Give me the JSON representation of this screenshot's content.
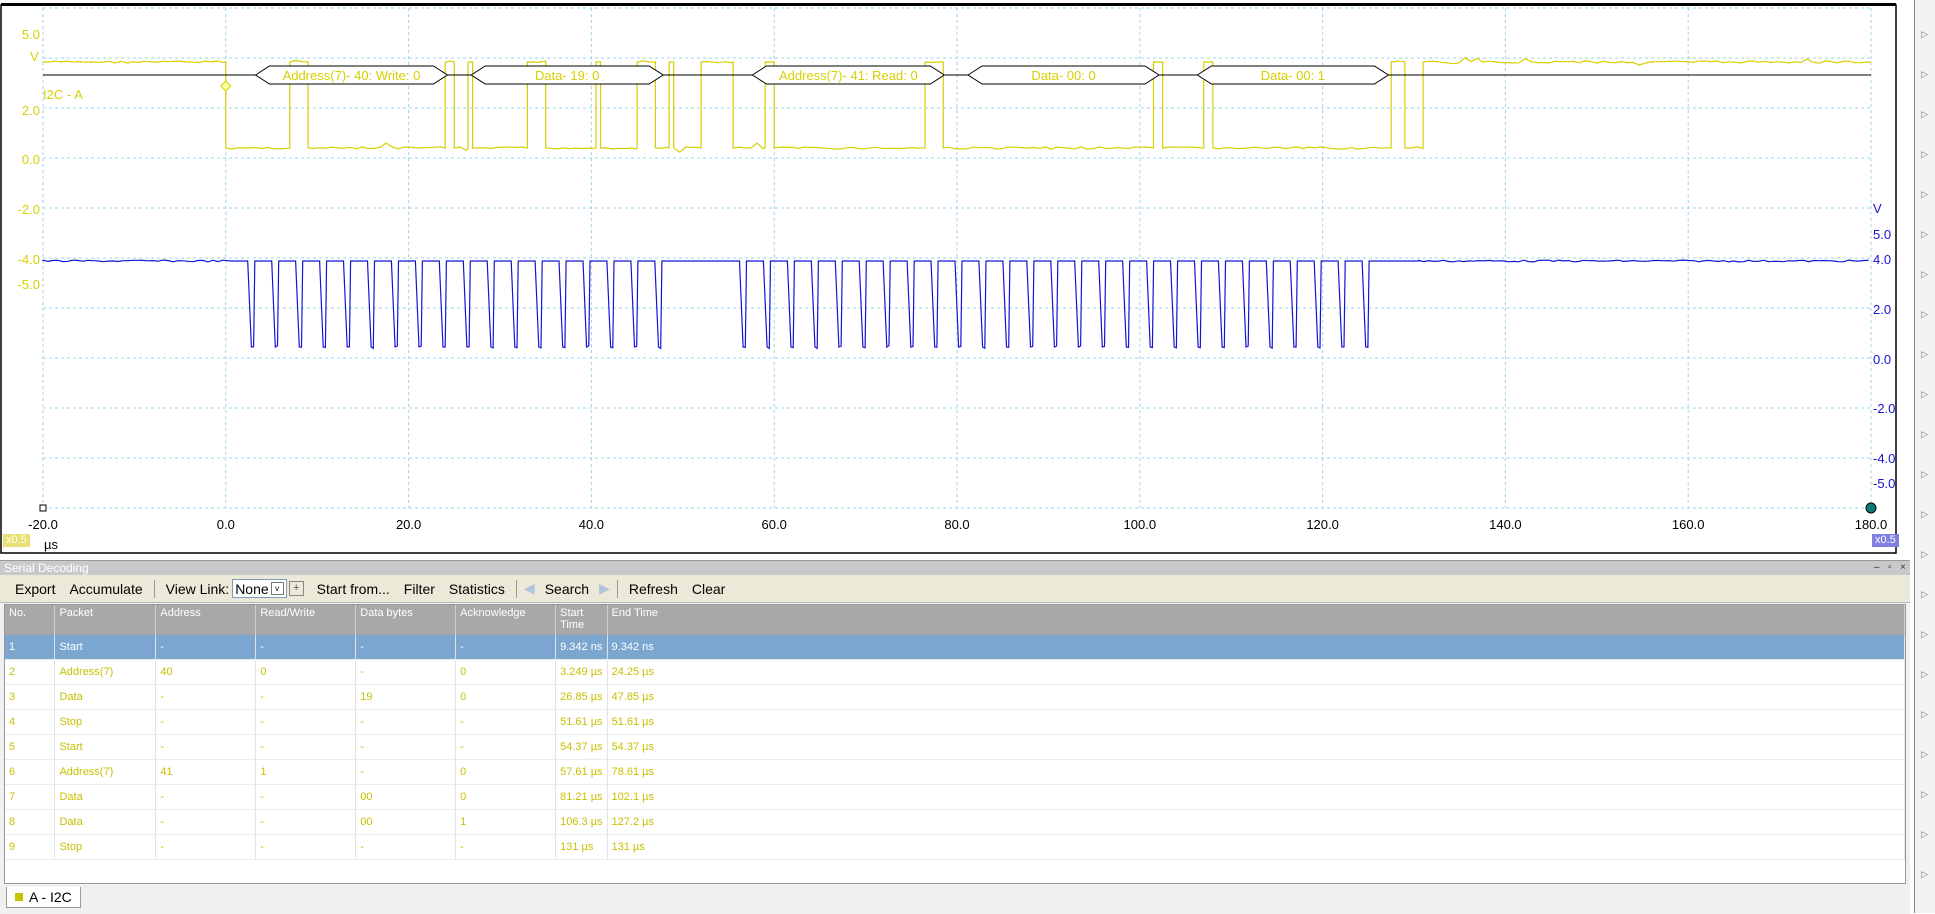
{
  "scope": {
    "channel_a": {
      "color": "#d6d000",
      "unit": "V",
      "axis_ticks": [
        "5.0",
        "2.0",
        "0.0",
        "-2.0",
        "-4.0",
        "-5.0"
      ],
      "scale_badge": "x0.5",
      "decoder_label": "I2C - A"
    },
    "channel_b": {
      "color": "#1414d4",
      "unit": "V",
      "axis_ticks": [
        "5.0",
        "4.0",
        "2.0",
        "0.0",
        "-2.0",
        "-4.0",
        "-5.0"
      ],
      "scale_badge": "x0.5"
    },
    "time_axis": {
      "ticks": [
        "-20.0",
        "0.0",
        "20.0",
        "40.0",
        "60.0",
        "80.0",
        "100.0",
        "120.0",
        "140.0",
        "160.0",
        "180.0"
      ],
      "unit": "µs"
    },
    "decode_packets": [
      {
        "label": "Address(7)- 40: Write: 0",
        "start_us": 3.249,
        "end_us": 24.25
      },
      {
        "label": "Data- 19: 0",
        "start_us": 26.85,
        "end_us": 47.85
      },
      {
        "label": "Address(7)- 41: Read: 0",
        "start_us": 57.61,
        "end_us": 78.61
      },
      {
        "label": "Data- 00: 0",
        "start_us": 81.21,
        "end_us": 102.1
      },
      {
        "label": "Data- 00: 1",
        "start_us": 106.3,
        "end_us": 127.2
      }
    ]
  },
  "panel": {
    "title": "Serial Decoding",
    "toolbar": {
      "export": "Export",
      "accumulate": "Accumulate",
      "view_link_label": "View Link:",
      "view_link_value": "None",
      "start_from": "Start from...",
      "filter": "Filter",
      "statistics": "Statistics",
      "search": "Search",
      "refresh": "Refresh",
      "clear": "Clear"
    },
    "table": {
      "columns": [
        "No.",
        "Packet",
        "Address",
        "Read/Write",
        "Data bytes",
        "Acknowledge",
        "Start Time",
        "End Time"
      ],
      "rows": [
        [
          "1",
          "Start",
          "-",
          "-",
          "-",
          "-",
          "9.342 ns",
          "9.342 ns"
        ],
        [
          "2",
          "Address(7)",
          "40",
          "0",
          "-",
          "0",
          "3.249 µs",
          "24.25 µs"
        ],
        [
          "3",
          "Data",
          "-",
          "-",
          "19",
          "0",
          "26.85 µs",
          "47.85 µs"
        ],
        [
          "4",
          "Stop",
          "-",
          "-",
          "-",
          "-",
          "51.61 µs",
          "51.61 µs"
        ],
        [
          "5",
          "Start",
          "-",
          "-",
          "-",
          "-",
          "54.37 µs",
          "54.37 µs"
        ],
        [
          "6",
          "Address(7)",
          "41",
          "1",
          "-",
          "0",
          "57.61 µs",
          "78.61 µs"
        ],
        [
          "7",
          "Data",
          "-",
          "-",
          "00",
          "0",
          "81.21 µs",
          "102.1 µs"
        ],
        [
          "8",
          "Data",
          "-",
          "-",
          "00",
          "1",
          "106.3 µs",
          "127.2 µs"
        ],
        [
          "9",
          "Stop",
          "-",
          "-",
          "-",
          "-",
          "131 µs",
          "131 µs"
        ]
      ],
      "selected_row": 0
    },
    "bottom_tab": "A - I2C"
  }
}
